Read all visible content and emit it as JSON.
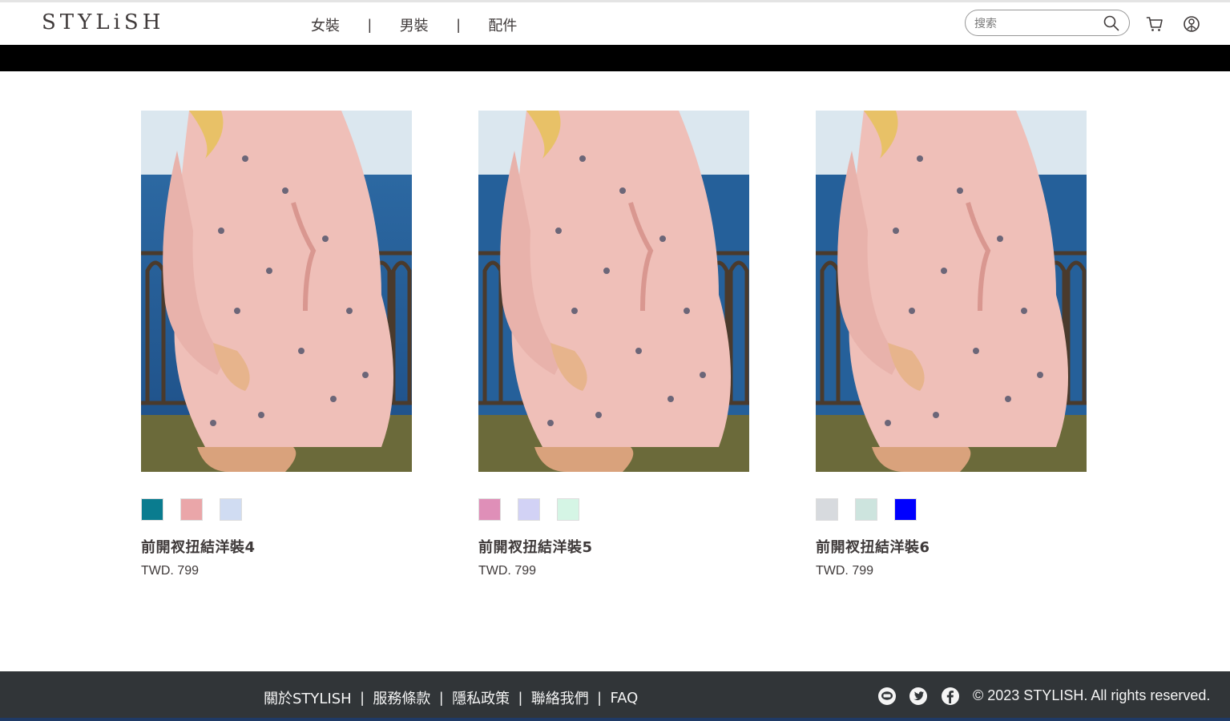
{
  "header": {
    "logo": "STYLiSH",
    "nav": [
      {
        "label": "女裝"
      },
      {
        "label": "男裝"
      },
      {
        "label": "配件"
      }
    ],
    "separator": "|",
    "search": {
      "placeholder": "搜索",
      "value": ""
    }
  },
  "products": [
    {
      "name": "前開衩扭結洋裝4",
      "price": "TWD. 799",
      "colors": [
        "#0a7c8f",
        "#eaa6a9",
        "#d0dcf2"
      ]
    },
    {
      "name": "前開衩扭結洋裝5",
      "price": "TWD. 799",
      "colors": [
        "#df8fb8",
        "#d2d2f5",
        "#d5f5e5"
      ]
    },
    {
      "name": "前開衩扭結洋裝6",
      "price": "TWD. 799",
      "colors": [
        "#d7dade",
        "#cde4de",
        "#0000ff"
      ]
    }
  ],
  "footer": {
    "links": [
      {
        "label": "關於STYLISH"
      },
      {
        "label": "服務條款"
      },
      {
        "label": "隱私政策"
      },
      {
        "label": "聯絡我們"
      },
      {
        "label": "FAQ"
      }
    ],
    "separator": "|",
    "copyright": "© 2023 STYLISH. All rights reserved."
  },
  "colors": {
    "text": "#3f3a3a",
    "banner": "#000000",
    "footer_bg": "#313538",
    "footer_text": "#f5f5f5"
  }
}
